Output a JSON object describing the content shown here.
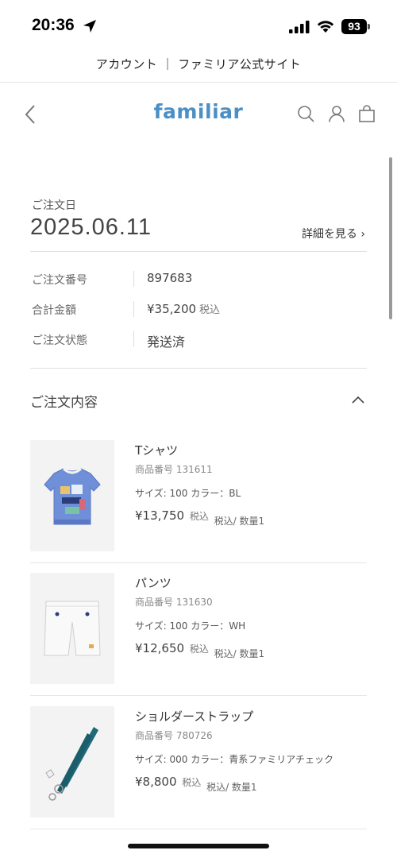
{
  "status_bar": {
    "time": "20:36",
    "battery": "93"
  },
  "page_title": "アカウント ｜ ファミリア公式サイト",
  "header": {
    "logo": "familiar"
  },
  "order": {
    "date_label": "ご注文日",
    "date": "2025.06.11",
    "detail_link": "詳細を見る ›",
    "rows": [
      {
        "label": "ご注文番号",
        "value": "897683",
        "suffix": ""
      },
      {
        "label": "合計金額",
        "value": "¥35,200",
        "suffix": "税込"
      },
      {
        "label": "ご注文状態",
        "value": "発送済",
        "suffix": ""
      }
    ]
  },
  "contents": {
    "title": "ご注文内容",
    "items": [
      {
        "name": "Tシャツ",
        "code": "商品番号 131611",
        "spec": "サイズ: 100 カラー：BL",
        "price": "¥13,750",
        "tax": "税込",
        "qty": "税込/ 数量1"
      },
      {
        "name": "パンツ",
        "code": "商品番号 131630",
        "spec": "サイズ: 100 カラー：WH",
        "price": "¥12,650",
        "tax": "税込",
        "qty": "税込/ 数量1"
      },
      {
        "name": "ショルダーストラップ",
        "code": "商品番号 780726",
        "spec": "サイズ: 000 カラー：青系ファミリアチェック",
        "price": "¥8,800",
        "tax": "税込",
        "qty": "税込/ 数量1"
      }
    ]
  },
  "colors": {
    "brand": "#4a8fc6"
  },
  "icons": [
    "location-arrow-icon",
    "signal-icon",
    "wifi-icon",
    "back-chevron-icon",
    "search-icon",
    "account-icon",
    "shopping-bag-icon",
    "chevron-up-icon"
  ]
}
